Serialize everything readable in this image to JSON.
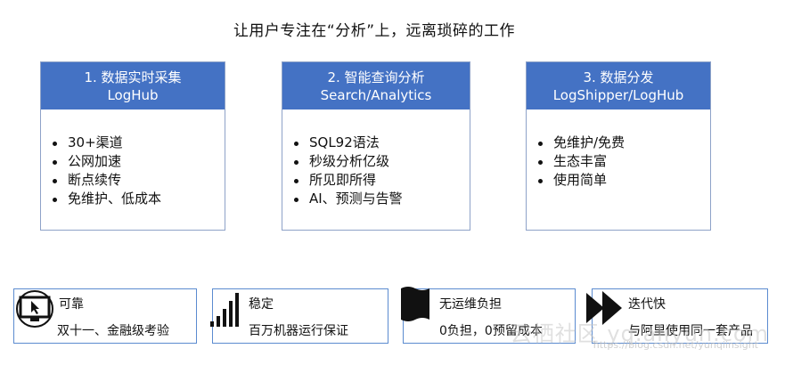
{
  "title": "让用户专注在“分析”上，远离琐碎的工作",
  "cards": [
    {
      "head_line1": "1. 数据实时采集",
      "head_line2": "LogHub",
      "items": [
        "30+渠道",
        "公网加速",
        "断点续传",
        "免维护、低成本"
      ]
    },
    {
      "head_line1": "2. 智能查询分析",
      "head_line2": "Search/Analytics",
      "items": [
        "SQL92语法",
        "秒级分析亿级",
        "所见即所得",
        "AI、预测与告警"
      ]
    },
    {
      "head_line1": "3. 数据分发",
      "head_line2": "LogShipper/LogHub",
      "items": [
        "免维护/免费",
        "生态丰富",
        "使用简单"
      ]
    }
  ],
  "features": [
    {
      "title": "可靠",
      "desc": "双十一、金融级考验",
      "icon": "monitor-cursor-icon"
    },
    {
      "title": "稳定",
      "desc": "百万机器运行保证",
      "icon": "signal-bars-icon"
    },
    {
      "title": "无运维负担",
      "desc": "0负担，0预留成本",
      "icon": "flag-icon"
    },
    {
      "title": "迭代快",
      "desc": "与阿里使用同一套产品",
      "icon": "fast-forward-icon"
    }
  ],
  "watermark": "云栖社区 yq.aliyun.com",
  "watermark_sub": "https://blog.csdn.net/yunqiinsight"
}
